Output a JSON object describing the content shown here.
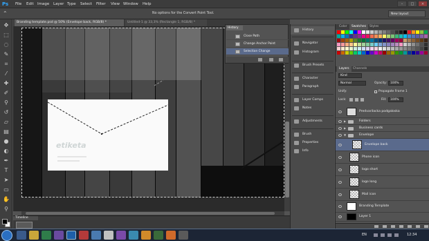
{
  "menubar": {
    "app_logo": "Ps",
    "items": [
      "File",
      "Edit",
      "Image",
      "Layer",
      "Type",
      "Select",
      "Filter",
      "View",
      "Window",
      "Help"
    ]
  },
  "options_bar": {
    "message": "No options for the Convert Point Tool.",
    "workspace": "New layout"
  },
  "documents": {
    "active_tab": "Branding template.psd @ 50% (Envelope back, RGB/8) *",
    "inactive_tab": "Untitled-1 @ 33,3% (Rectangle 1, RGB/8) *"
  },
  "canvas": {
    "logo_text": "etiketa"
  },
  "history": {
    "tab_label": "History",
    "rows": [
      "Close Path",
      "Change Anchor Point",
      "Selection Change"
    ]
  },
  "dock": {
    "items": [
      "History",
      "Navigator",
      "Histogram",
      "Brush Presets",
      "Character",
      "Paragraph",
      "Layer Comps",
      "Notes",
      "Adjustments",
      "Brush",
      "Properties",
      "Info"
    ]
  },
  "swatches": {
    "tabs": [
      "Color",
      "Swatches",
      "Styles"
    ],
    "active": "Swatches"
  },
  "layers_panel": {
    "tabs": [
      "Layers",
      "Channels"
    ],
    "kind": "Kind",
    "blend_mode": "Normal",
    "opacity_label": "Opacity:",
    "opacity_value": "100%",
    "unify_label": "Unify:",
    "propagate_label": "Propagate Frame 1",
    "lock_label": "Lock:",
    "fill_label": "Fill:",
    "fill_value": "100%",
    "layers": [
      "Predvarilacka podgaloska",
      "Folders",
      "Business cards",
      "Envelope",
      "Envelope back",
      "Phone icon",
      "logo short",
      "logo long",
      "Mail icon",
      "Branding Template",
      "Layer 1"
    ]
  },
  "timeline": {
    "tab_label": "Timeline"
  },
  "taskbar": {
    "language": "EN",
    "time": "12:34"
  },
  "colors": {
    "app_bg": "#535353",
    "selected_layer": "#5a6a8c",
    "ps_blue": "#31a8ff"
  }
}
